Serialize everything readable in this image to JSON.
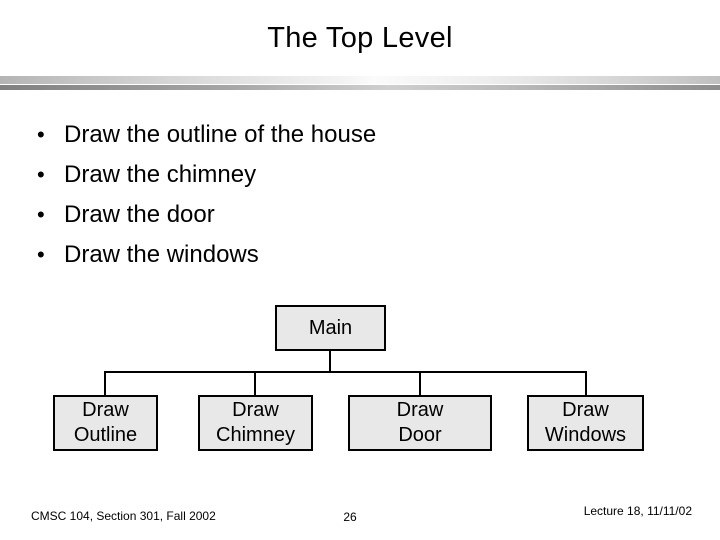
{
  "slide": {
    "title": "The Top Level",
    "bullet_marker": "•",
    "bullets": [
      {
        "text": "Draw the outline of the house"
      },
      {
        "text": "Draw the chimney"
      },
      {
        "text": "Draw the door"
      },
      {
        "text": "Draw the windows"
      }
    ]
  },
  "diagram": {
    "type": "tree",
    "root": {
      "label": "Main",
      "line1": "Main",
      "line2": ""
    },
    "children": [
      {
        "label": "Draw Outline",
        "line1": "Draw",
        "line2": "Outline"
      },
      {
        "label": "Draw Chimney",
        "line1": "Draw",
        "line2": "Chimney"
      },
      {
        "label": "Draw Door",
        "line1": "Draw",
        "line2": "Door"
      },
      {
        "label": "Draw Windows",
        "line1": "Draw",
        "line2": "Windows"
      }
    ],
    "box_fill": "#e8e8e8",
    "box_border": "#000000"
  },
  "footer": {
    "course": "CMSC 104, Section 301, Fall 2002",
    "page_number": "26",
    "lecture": "Lecture 18, 11/11/02"
  }
}
